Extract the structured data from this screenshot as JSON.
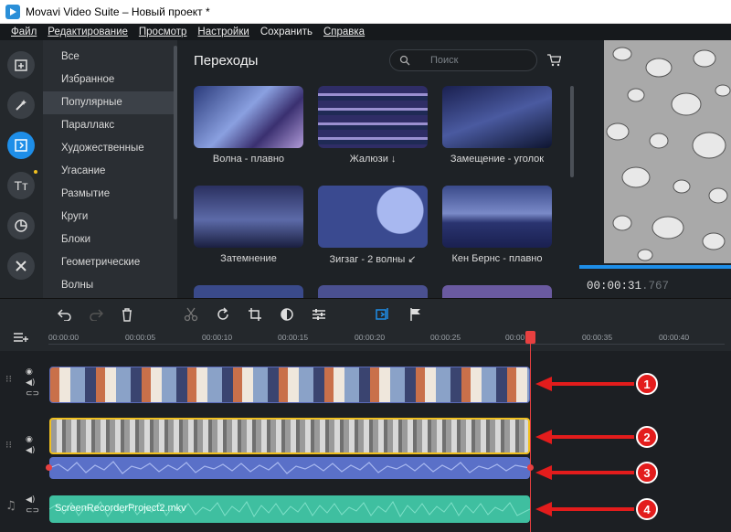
{
  "window": {
    "title": "Movavi Video Suite – Новый проект *"
  },
  "menu": [
    "Файл",
    "Редактирование",
    "Просмотр",
    "Настройки",
    "Сохранить",
    "Справка"
  ],
  "sidebar_tools": [
    "import-icon",
    "magic-wand-icon",
    "transitions-icon",
    "titles-icon",
    "stickers-icon",
    "tools-icon"
  ],
  "categories": [
    "Все",
    "Избранное",
    "Популярные",
    "Параллакс",
    "Художественные",
    "Угасание",
    "Размытие",
    "Круги",
    "Блоки",
    "Геометрические",
    "Волны"
  ],
  "selected_category": "Популярные",
  "gallery": {
    "title": "Переходы",
    "search_placeholder": "Поиск",
    "items": [
      "Волна - плавно",
      "Жалюзи ↓",
      "Замещение - уголок",
      "Затемнение",
      "Зигзаг - 2 волны ↙",
      "Кен Бернс - плавно"
    ]
  },
  "preview": {
    "time_main": "00:00:31",
    "time_ms": ".767"
  },
  "ruler": [
    "00:00:00",
    "00:00:05",
    "00:00:10",
    "00:00:15",
    "00:00:20",
    "00:00:25",
    "00:00:30",
    "00:00:35",
    "00:00:40"
  ],
  "tracks": {
    "audio_clip_name": "ScreenRecorderProject2.mkv"
  },
  "callouts": [
    "1",
    "2",
    "3",
    "4"
  ],
  "colors": {
    "accent": "#1e8ee8",
    "playhead": "#e84040",
    "callout": "#e31c1c",
    "audio_clip": "#3fbfa0"
  }
}
